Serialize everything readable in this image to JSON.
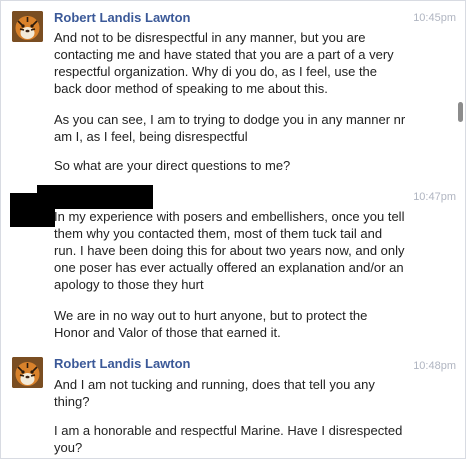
{
  "messages": [
    {
      "sender": "Robert Landis Lawton",
      "time": "10:45pm",
      "avatar_icon": "tiger-avatar-icon",
      "paragraphs": [
        "And not to be disrespectful in any manner, but you are contacting me and have stated that you are a part of a very respectful organization.  Why di you do, as I feel, use the back door method of speaking to me about this.",
        "As you can see, I am to trying to dodge you in any manner nr am I, as I feel, being disrespectful",
        "So what are your direct questions to me?"
      ]
    },
    {
      "sender": "",
      "time": "10:47pm",
      "sender_redacted": true,
      "paragraphs": [
        "In my experience with posers and embellishers, once you tell them why you contacted them, most of them tuck tail and run. I have been doing this for about two years now, and only one poser has ever actually offered an explanation and/or an apology to those they hurt",
        "We are in no way out to hurt anyone, but to protect the Honor and Valor of those that earned it."
      ]
    },
    {
      "sender": "Robert Landis Lawton",
      "time": "10:48pm",
      "avatar_icon": "tiger-avatar-icon",
      "paragraphs": [
        "And I am not tucking and running, does that tell you any thing?",
        "I am a honorable and respectful Marine.  Have I disrespected you?"
      ]
    }
  ],
  "colors": {
    "sender_name": "#3b5998",
    "timestamp": "#b0b5c1",
    "text": "#222222",
    "redaction": "#000000"
  }
}
